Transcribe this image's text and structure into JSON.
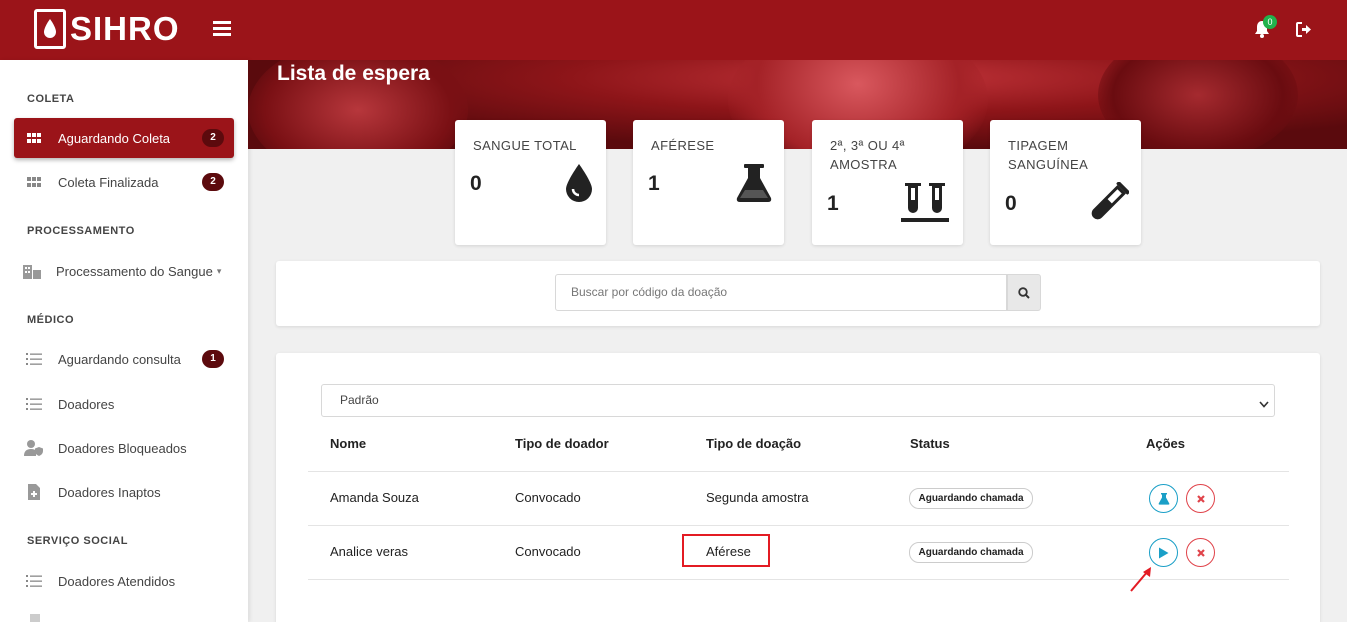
{
  "header": {
    "brand": "SIHRO",
    "notification_count": "0"
  },
  "sidebar": {
    "sections": [
      {
        "label": "COLETA"
      },
      {
        "label": "PROCESSAMENTO"
      },
      {
        "label": "MÉDICO"
      },
      {
        "label": "SERVIÇO SOCIAL"
      }
    ],
    "items": [
      {
        "label": "Aguardando Coleta",
        "badge": "2",
        "icon": "grid-icon"
      },
      {
        "label": "Coleta Finalizada",
        "badge": "2",
        "icon": "grid-icon"
      },
      {
        "label": "Processamento do Sangue",
        "icon": "building-icon"
      },
      {
        "label": "Aguardando consulta",
        "badge": "1",
        "icon": "list-icon"
      },
      {
        "label": "Doadores",
        "icon": "list-icon"
      },
      {
        "label": "Doadores Bloqueados",
        "icon": "user-shield-icon"
      },
      {
        "label": "Doadores Inaptos",
        "icon": "file-medical-icon"
      },
      {
        "label": "Doadores Atendidos",
        "icon": "list-icon"
      }
    ]
  },
  "page": {
    "title": "Lista de espera"
  },
  "cards": [
    {
      "title": "SANGUE TOTAL",
      "value": "0",
      "icon": "blood-drop-icon"
    },
    {
      "title": "AFÉRESE",
      "value": "1",
      "icon": "flask-icon"
    },
    {
      "title_line1": "2ª, 3ª OU 4ª",
      "title_line2": "AMOSTRA",
      "value": "1",
      "icon": "test-tubes-icon"
    },
    {
      "title_line1": "TIPAGEM",
      "title_line2": "SANGUÍNEA",
      "value": "0",
      "icon": "vial-icon"
    }
  ],
  "search": {
    "placeholder": "Buscar por código da doação"
  },
  "filter": {
    "selected": "Padrão"
  },
  "table": {
    "columns": [
      "Nome",
      "Tipo de doador",
      "Tipo de doação",
      "Status",
      "Ações"
    ],
    "rows": [
      {
        "nome": "Amanda Souza",
        "tipo_doador": "Convocado",
        "tipo_doacao": "Segunda amostra",
        "status": "Aguardando chamada",
        "action": "flask-icon"
      },
      {
        "nome": "Analice veras",
        "tipo_doador": "Convocado",
        "tipo_doacao": "Aférese",
        "status": "Aguardando chamada",
        "action": "play-icon"
      }
    ]
  },
  "colors": {
    "brand": "#9b1419",
    "badge": "#5c0a0d",
    "teal": "#1a9fc7",
    "danger": "#e0434a",
    "highlight": "#e31b23"
  }
}
